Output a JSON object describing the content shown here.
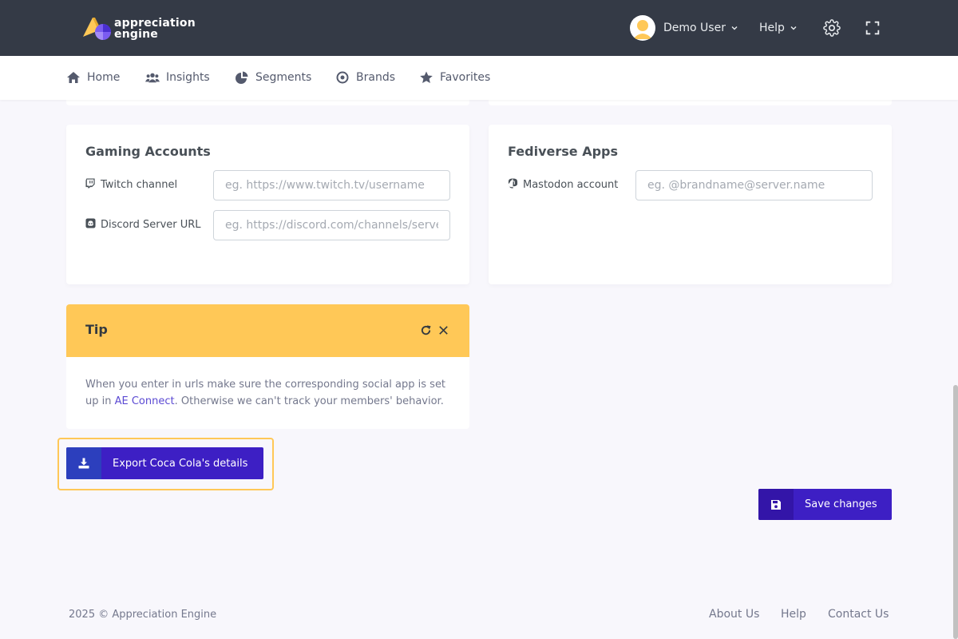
{
  "brand": {
    "logo_line1": "appreciation",
    "logo_line2": "engine"
  },
  "header": {
    "user_name": "Demo User",
    "help_label": "Help",
    "icons": [
      "user-avatar",
      "chevron-down-icon",
      "gear-icon",
      "fullscreen-icon"
    ]
  },
  "nav": {
    "items": [
      {
        "label": "Home",
        "icon": "home-icon"
      },
      {
        "label": "Insights",
        "icon": "users-icon"
      },
      {
        "label": "Segments",
        "icon": "pie-chart-icon"
      },
      {
        "label": "Brands",
        "icon": "target-icon"
      },
      {
        "label": "Favorites",
        "icon": "star-icon"
      }
    ]
  },
  "gaming": {
    "title": "Gaming Accounts",
    "twitch_label": "Twitch channel",
    "twitch_placeholder": "eg. https://www.twitch.tv/username",
    "discord_label": "Discord Server URL",
    "discord_placeholder": "eg. https://discord.com/channels/server"
  },
  "fediverse": {
    "title": "Fediverse Apps",
    "mastodon_label": "Mastodon account",
    "mastodon_placeholder": "eg. @brandname@server.name"
  },
  "tip": {
    "title": "Tip",
    "text_before": "When you enter in urls make sure the corresponding social app is set up in ",
    "link": "AE Connect",
    "text_after": ". Otherwise we can't track your members' behavior."
  },
  "actions": {
    "export_label": "Export Coca Cola's details",
    "save_label": "Save changes"
  },
  "footer": {
    "copyright": "2025 © Appreciation Engine",
    "links": [
      "About Us",
      "Help",
      "Contact Us"
    ]
  },
  "colors": {
    "topbar": "#343a46",
    "accent_purple": "#3b1fc2",
    "tip_yellow": "#ffc857",
    "link": "#5b4ad3"
  }
}
